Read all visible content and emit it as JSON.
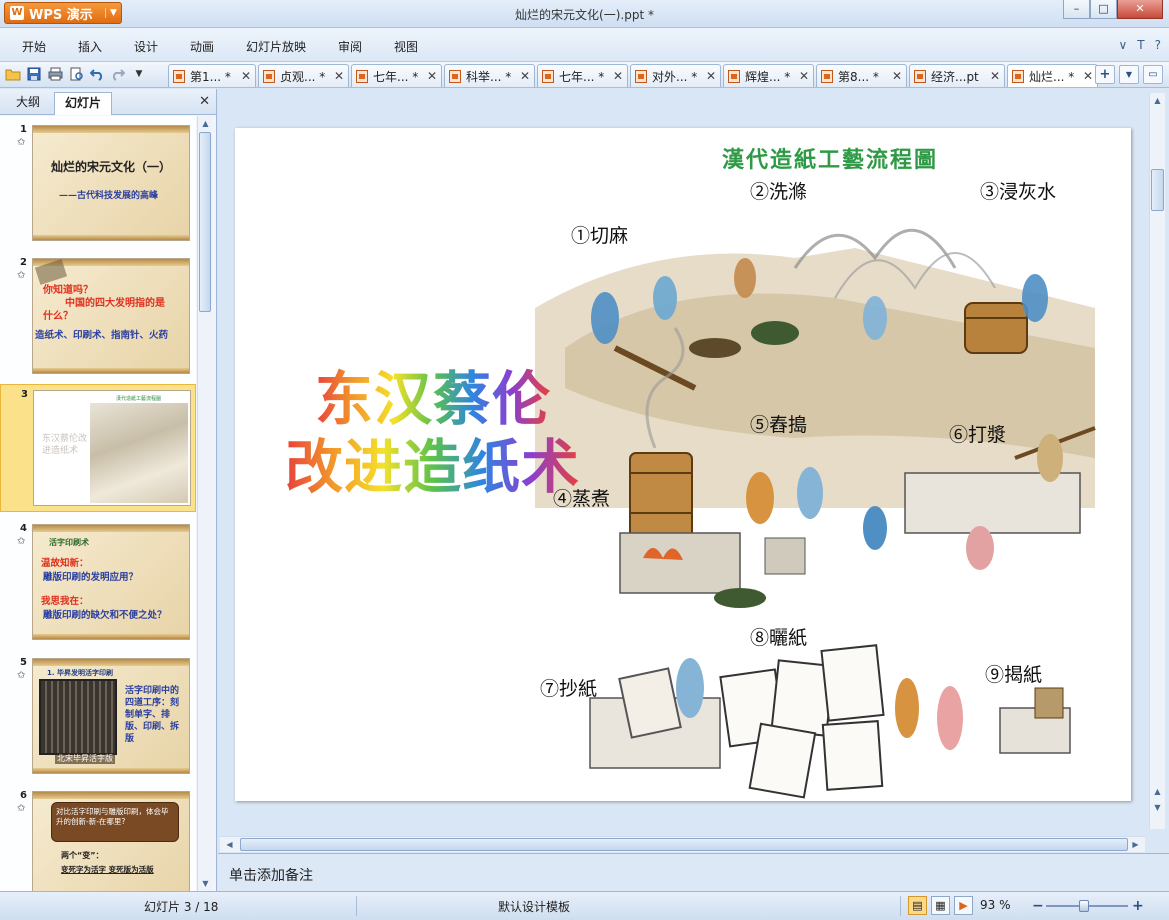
{
  "app": {
    "name": "WPS 演示",
    "logo_letter": "W",
    "document_title": "灿烂的宋元文化(一).ppt *"
  },
  "window_controls": {
    "minimize": "–",
    "maximize": "□",
    "close": "✕"
  },
  "menu": [
    "开始",
    "插入",
    "设计",
    "动画",
    "幻灯片放映",
    "审阅",
    "视图"
  ],
  "menu_right": [
    "∨",
    "T",
    "?"
  ],
  "doc_tabs": [
    {
      "label": "第1... *",
      "active": false
    },
    {
      "label": "贞观... *",
      "active": false
    },
    {
      "label": "七年... *",
      "active": false
    },
    {
      "label": "科举... *",
      "active": false
    },
    {
      "label": "七年... *",
      "active": false
    },
    {
      "label": "对外... *",
      "active": false
    },
    {
      "label": "辉煌... *",
      "active": false
    },
    {
      "label": "第8... *",
      "active": false
    },
    {
      "label": "经济...pt",
      "active": false
    },
    {
      "label": "灿烂... *",
      "active": true
    }
  ],
  "pane_tabs": {
    "outline": "大纲",
    "slides": "幻灯片"
  },
  "thumbnails": [
    {
      "num": "1",
      "title": "灿烂的宋元文化（一）",
      "subtitle": "——古代科技发展的高峰"
    },
    {
      "num": "2",
      "q1": "你知道吗？",
      "q2": "中国的四大发明指的是",
      "q3": "什么？",
      "answer": "造纸术、印刷术、指南针、火药"
    },
    {
      "num": "3",
      "selected": true,
      "mini_title": "漢代造紙工藝流程圖",
      "mini_text": "东汉蔡伦改进造纸术"
    },
    {
      "num": "4",
      "header": "活字印刷术",
      "l1": "温故知新：",
      "l2": "雕版印刷的发明应用？",
      "l3": "我思我在：",
      "l4": "雕版印刷的缺欠和不便之处？"
    },
    {
      "num": "5",
      "header": "1. 毕昇发明活字印刷",
      "body": "活字印刷中的四道工序：刻制单字、排版、印刷、拆版",
      "caption": "北宋毕昇活字版"
    },
    {
      "num": "6",
      "box": "对比活字印刷与雕版印刷，体会毕升的创新-新-在哪里?",
      "l1": "两个“变”：",
      "l2": "变死字为活字   变死版为活版"
    }
  ],
  "slide": {
    "wordart_line1": "东汉蔡伦",
    "wordart_line2": "改进造纸术",
    "diagram_title": "漢代造紙工藝流程圖",
    "steps": [
      "①切麻",
      "②洗滌",
      "③浸灰水",
      "④蒸煮",
      "⑤舂搗",
      "⑥打漿",
      "⑦抄紙",
      "⑧曬紙",
      "⑨揭紙"
    ]
  },
  "notes_placeholder": "单击添加备注",
  "status": {
    "slide_counter": "幻灯片 3 / 18",
    "template": "默认设计模板",
    "zoom": "93 %",
    "zoom_percent": 93
  }
}
